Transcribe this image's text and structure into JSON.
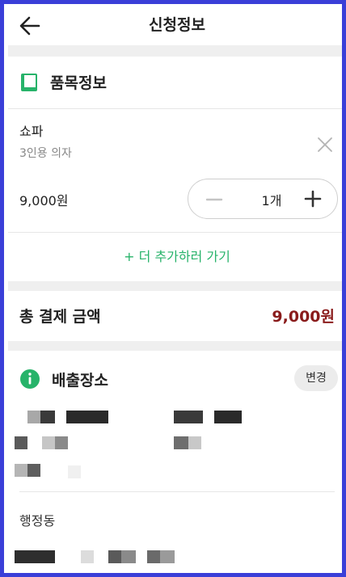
{
  "header": {
    "title": "신청정보",
    "back_icon": "arrow-left-icon"
  },
  "item_section": {
    "title": "품목정보",
    "icon": "document-icon",
    "icon_color": "#27b36a"
  },
  "item": {
    "name": "쇼파",
    "description": "3인용 의자",
    "price": "9,000원",
    "quantity": "1개",
    "remove_icon": "close-icon",
    "minus_icon": "minus-icon",
    "plus_icon": "plus-icon"
  },
  "add_more_label": "+ 더 추가하러 가기",
  "total": {
    "label": "총 결제 금액",
    "amount": "9,000원",
    "amount_color": "#8a1c1c"
  },
  "destination": {
    "title": "배출장소",
    "icon": "info-icon",
    "icon_color": "#27b36a",
    "change_label": "변경",
    "address_redacted": true,
    "region_label": "행정동"
  },
  "colors": {
    "accent": "#27b36a",
    "frame": "#3a3fd8",
    "section_gap": "#efefef"
  }
}
